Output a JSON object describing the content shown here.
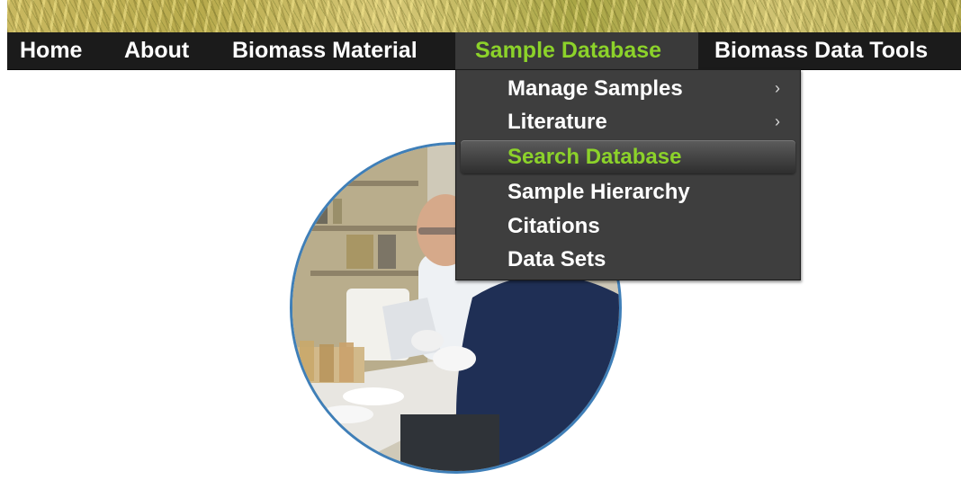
{
  "nav": {
    "items": [
      {
        "label": "Home"
      },
      {
        "label": "About"
      },
      {
        "label": "Biomass Material"
      },
      {
        "label": "Sample Database"
      },
      {
        "label": "Biomass Data Tools"
      }
    ],
    "active_color": "#8cd22a",
    "bar_color": "#1b1b1b"
  },
  "dropdown": {
    "items": [
      {
        "label": "Manage Samples",
        "submenu_icon": "chevron-right-icon",
        "arrow": "›"
      },
      {
        "label": "Literature",
        "submenu_icon": "chevron-right-icon",
        "arrow": "›"
      },
      {
        "label": "Search Database",
        "highlighted": true
      },
      {
        "label": "Sample Hierarchy"
      },
      {
        "label": "Citations"
      },
      {
        "label": "Data Sets"
      }
    ]
  },
  "photo": {
    "subject": "lab-scientists-photo",
    "border_color": "#3f7fb8"
  }
}
